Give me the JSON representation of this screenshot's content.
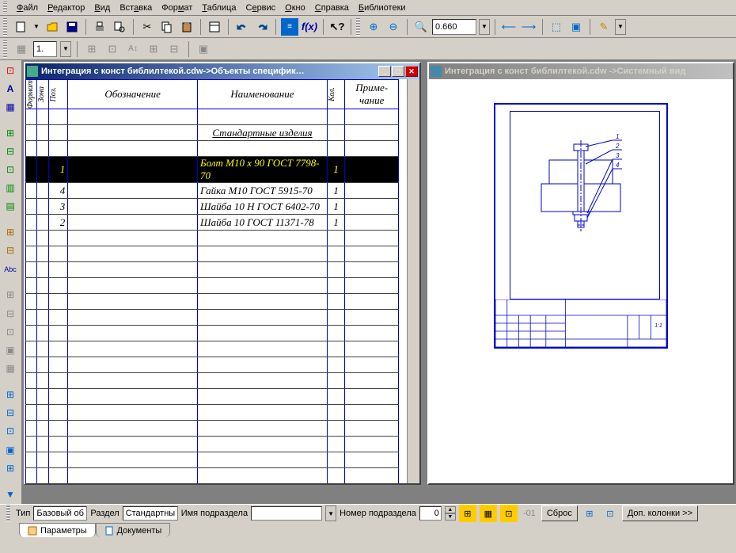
{
  "menu": {
    "file": "Файл",
    "editor": "Редактор",
    "view": "Вид",
    "insert": "Вставка",
    "format": "Формат",
    "table": "Таблица",
    "service": "Сервис",
    "window": "Окно",
    "help": "Справка",
    "libraries": "Библиотеки"
  },
  "toolbar": {
    "zoom_value": "0.660"
  },
  "toolbar2": {
    "step_value": "1."
  },
  "spec_window": {
    "title": "Интеграция с конст библилтекой.cdw->Объекты специфик…"
  },
  "draw_window": {
    "title": "Интеграция с конст библилтекой.cdw ->Системный вид"
  },
  "spec_table": {
    "headers": {
      "format": "Формат",
      "zone": "Зона",
      "pos": "Поз.",
      "designation": "Обозначение",
      "name": "Наименование",
      "qty": "Кол.",
      "note": "Приме-\nчание"
    },
    "section_header": "Стандартные изделия",
    "rows": [
      {
        "pos": "1",
        "name": "Болт М10 x 90 ГОСТ 7798-70",
        "qty": "1",
        "selected": true
      },
      {
        "pos": "4",
        "name": "Гайка М10 ГОСТ 5915-70",
        "qty": "1",
        "selected": false
      },
      {
        "pos": "3",
        "name": "Шайба 10 Н ГОСТ 6402-70",
        "qty": "1",
        "selected": false
      },
      {
        "pos": "2",
        "name": "Шайба 10 ГОСТ 11371-78",
        "qty": "1",
        "selected": false
      }
    ]
  },
  "drawing": {
    "callouts": [
      "1",
      "2",
      "3",
      "4"
    ]
  },
  "bottom": {
    "type_label": "Тип",
    "type_value": "Базовый об",
    "section_label": "Раздел",
    "section_value": "Стандартны",
    "subsection_name_label": "Имя подраздела",
    "subsection_name_value": "",
    "subsection_num_label": "Номер подраздела",
    "subsection_num_value": "0",
    "reset_btn": "Сброс",
    "extra_cols": "Доп. колонки  >>",
    "tab_params": "Параметры",
    "tab_docs": "Документы"
  }
}
